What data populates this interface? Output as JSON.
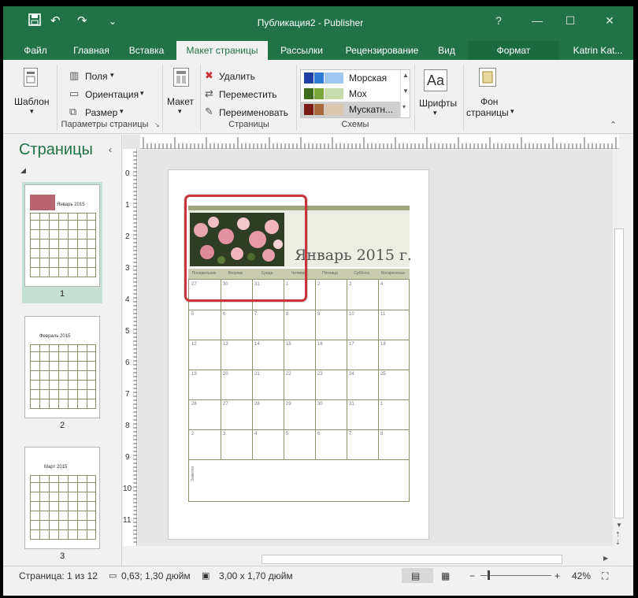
{
  "window": {
    "title": "Публикация2 - Publisher",
    "quick_access": {
      "undo": "↶",
      "redo": "↷",
      "more": "⌄"
    },
    "controls": {
      "help": "?",
      "minimize": "—",
      "maximize": "☐",
      "close": "✕"
    }
  },
  "tabs": [
    {
      "label": "Файл"
    },
    {
      "label": "Главная"
    },
    {
      "label": "Вставка"
    },
    {
      "label": "Макет страницы"
    },
    {
      "label": "Рассылки"
    },
    {
      "label": "Рецензирование"
    },
    {
      "label": "Вид"
    },
    {
      "label": "Формат"
    }
  ],
  "user": "Katrin Kat...",
  "ribbon": {
    "template": {
      "label": "Шаблон"
    },
    "page_setup": {
      "margins": "Поля",
      "orientation": "Ориентация",
      "size": "Размер",
      "group_label": "Параметры страницы"
    },
    "layout": {
      "label": "Макет"
    },
    "pages": {
      "delete": "Удалить",
      "move": "Переместить",
      "rename": "Переименовать",
      "group_label": "Страницы"
    },
    "schemes": {
      "items": [
        {
          "name": "Морская",
          "colors": [
            "#1f3fa8",
            "#2f7bd6",
            "#9fc7f0"
          ]
        },
        {
          "name": "Мох",
          "colors": [
            "#3f6b1f",
            "#7aa63a",
            "#c9dcae"
          ]
        },
        {
          "name": "Мускатн...",
          "colors": [
            "#7a1a14",
            "#a86a3a",
            "#d9c7b0"
          ]
        }
      ],
      "group_label": "Схемы"
    },
    "fonts": {
      "label": "Шрифты",
      "icon_text": "Aa"
    },
    "background": {
      "label_line1": "Фон",
      "label_line2": "страницы"
    }
  },
  "pages_pane": {
    "title": "Страницы",
    "pages": [
      {
        "number": "1",
        "month": "Январь 2015"
      },
      {
        "number": "2",
        "month": "Февраль 2015"
      },
      {
        "number": "3",
        "month": "Март 2015"
      }
    ]
  },
  "ruler": {
    "vertical_labels": [
      "0",
      "1",
      "2",
      "3",
      "4",
      "5",
      "6",
      "7",
      "8",
      "9",
      "10",
      "11"
    ]
  },
  "calendar": {
    "month_title": "Январь 2015 г.",
    "day_names": [
      "Понедельник",
      "Вторник",
      "Среда",
      "Четверг",
      "Пятница",
      "Суббота",
      "Воскресенье"
    ],
    "weeks": [
      [
        "27",
        "30",
        "31",
        "1",
        "2",
        "3",
        "4"
      ],
      [
        "5",
        "6",
        "7",
        "8",
        "9",
        "10",
        "11"
      ],
      [
        "12",
        "13",
        "14",
        "15",
        "16",
        "17",
        "18"
      ],
      [
        "19",
        "20",
        "21",
        "22",
        "23",
        "24",
        "25"
      ],
      [
        "26",
        "27",
        "28",
        "29",
        "30",
        "31",
        "1"
      ],
      [
        "2",
        "3",
        "4",
        "5",
        "6",
        "7",
        "8"
      ]
    ],
    "notes_label": "Заметки"
  },
  "status": {
    "page": "Страница: 1 из 12",
    "position": "0,63; 1,30 дюйм",
    "size": "3,00 x 1,70 дюйм",
    "zoom": "42%"
  },
  "colors": {
    "accent": "#217346",
    "selection": "#c9333a",
    "calendar_line": "#8c9066"
  }
}
